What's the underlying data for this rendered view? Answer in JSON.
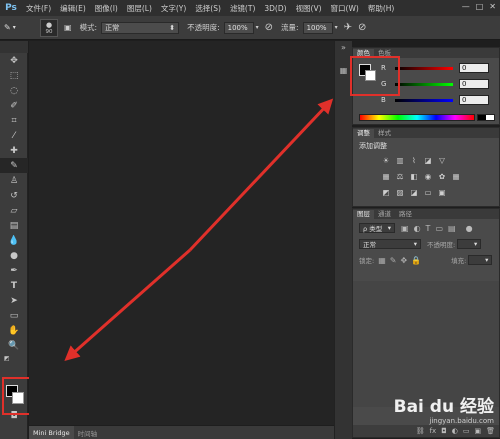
{
  "app": {
    "logo": "Ps"
  },
  "menu": [
    "文件(F)",
    "编辑(E)",
    "图像(I)",
    "图层(L)",
    "文字(Y)",
    "选择(S)",
    "滤镜(T)",
    "3D(D)",
    "视图(V)",
    "窗口(W)",
    "帮助(H)"
  ],
  "window_controls": {
    "minimize": "—",
    "maximize": "□",
    "close": "✕"
  },
  "options": {
    "brush_size": "90",
    "mode_label": "模式:",
    "mode_value": "正常",
    "opacity_label": "不透明度:",
    "opacity_value": "100%",
    "flow_label": "流量:",
    "flow_value": "100%"
  },
  "color_panel": {
    "tabs": [
      "颜色",
      "色板"
    ],
    "channels": [
      {
        "label": "R",
        "value": "0",
        "color": "#e03030"
      },
      {
        "label": "G",
        "value": "0",
        "color": "#30c030"
      },
      {
        "label": "B",
        "value": "0",
        "color": "#3050e0"
      }
    ]
  },
  "adjust_panel": {
    "tabs": [
      "调整",
      "样式"
    ],
    "title": "添加调整"
  },
  "layers_panel": {
    "tabs": [
      "图层",
      "通道",
      "路径"
    ],
    "filter_label": "ρ 类型",
    "blend_mode": "正常",
    "opacity_label": "不透明度:",
    "lock_label": "锁定:",
    "fill_label": "填充:"
  },
  "bottom_tabs": [
    "Mini Bridge",
    "时间轴"
  ],
  "watermark": {
    "logo": "Bai du 经验",
    "url": "jingyan.baidu.com"
  },
  "colors": {
    "annotation_red": "#e0302a",
    "foreground": "#000000",
    "background": "#ffffff"
  }
}
